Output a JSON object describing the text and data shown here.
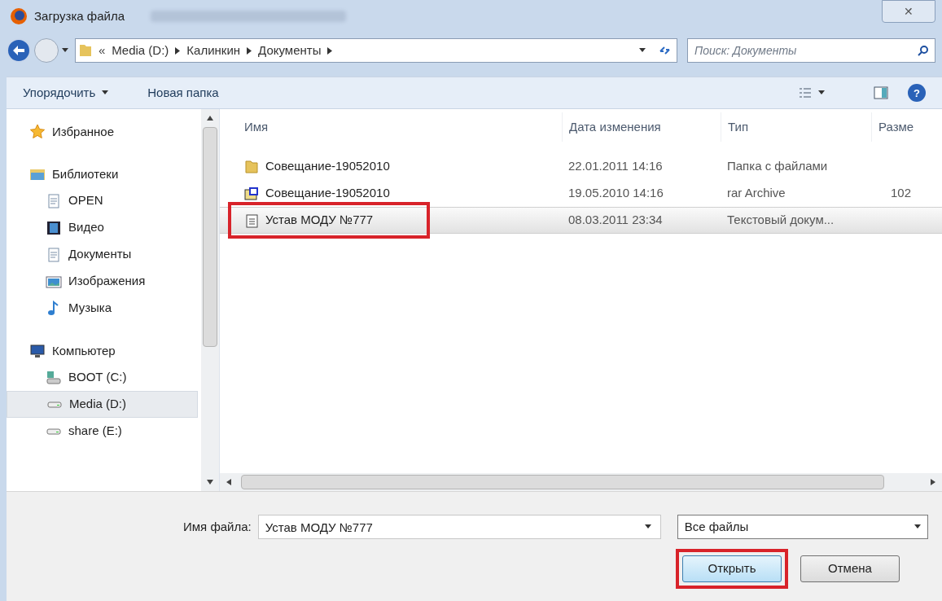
{
  "window": {
    "title": "Загрузка файла",
    "close": "✕"
  },
  "address_bar": {
    "overflow": "«",
    "crumbs": [
      "Media (D:)",
      "Калинкин",
      "Документы"
    ],
    "search_placeholder": "Поиск: Документы"
  },
  "toolbar": {
    "items": [
      "Упорядочить",
      "Новая папка"
    ],
    "help": "?"
  },
  "sidebar": {
    "groups": [
      {
        "label": "Избранное",
        "kind": "star"
      },
      {
        "label": "Библиотеки",
        "kind": "library",
        "children": [
          {
            "label": "OPEN",
            "kind": "doc",
            "selected": false
          },
          {
            "label": "Видео",
            "kind": "video",
            "selected": false
          },
          {
            "label": "Документы",
            "kind": "doc",
            "selected": false
          },
          {
            "label": "Изображения",
            "kind": "image",
            "selected": false
          },
          {
            "label": "Музыка",
            "kind": "music",
            "selected": false
          }
        ]
      },
      {
        "label": "Компьютер",
        "kind": "computer",
        "children": [
          {
            "label": "BOOT (C:)",
            "kind": "windrive",
            "selected": false
          },
          {
            "label": "Media (D:)",
            "kind": "drive",
            "selected": true
          },
          {
            "label": "share (E:)",
            "kind": "drive",
            "selected": false
          }
        ]
      }
    ]
  },
  "table": {
    "columns": [
      "Имя",
      "Дата изменения",
      "Тип",
      "Разме"
    ],
    "rows": [
      {
        "kind": "folder",
        "name": "Совещание-19052010",
        "date": "22.01.2011 14:16",
        "type": "Папка с файлами",
        "selected": false,
        "annotated": false
      },
      {
        "kind": "archive",
        "name": "Совещание-19052010",
        "date": "19.05.2010 14:16",
        "type": "rar Archive",
        "size": "102",
        "selected": false,
        "annotated": false
      },
      {
        "kind": "text",
        "name": "Устав МОДУ №777",
        "date": "08.03.2011 23:34",
        "type": "Текстовый докум...",
        "selected": true,
        "annotated": true
      }
    ]
  },
  "footer": {
    "filename_label": "Имя файла:",
    "filename": "Устав МОДУ №777",
    "filter": "Все файлы",
    "buttons": [
      {
        "label": "Открыть",
        "annotated": true,
        "default": true
      },
      {
        "label": "Отмена",
        "annotated": false,
        "default": false
      }
    ]
  }
}
